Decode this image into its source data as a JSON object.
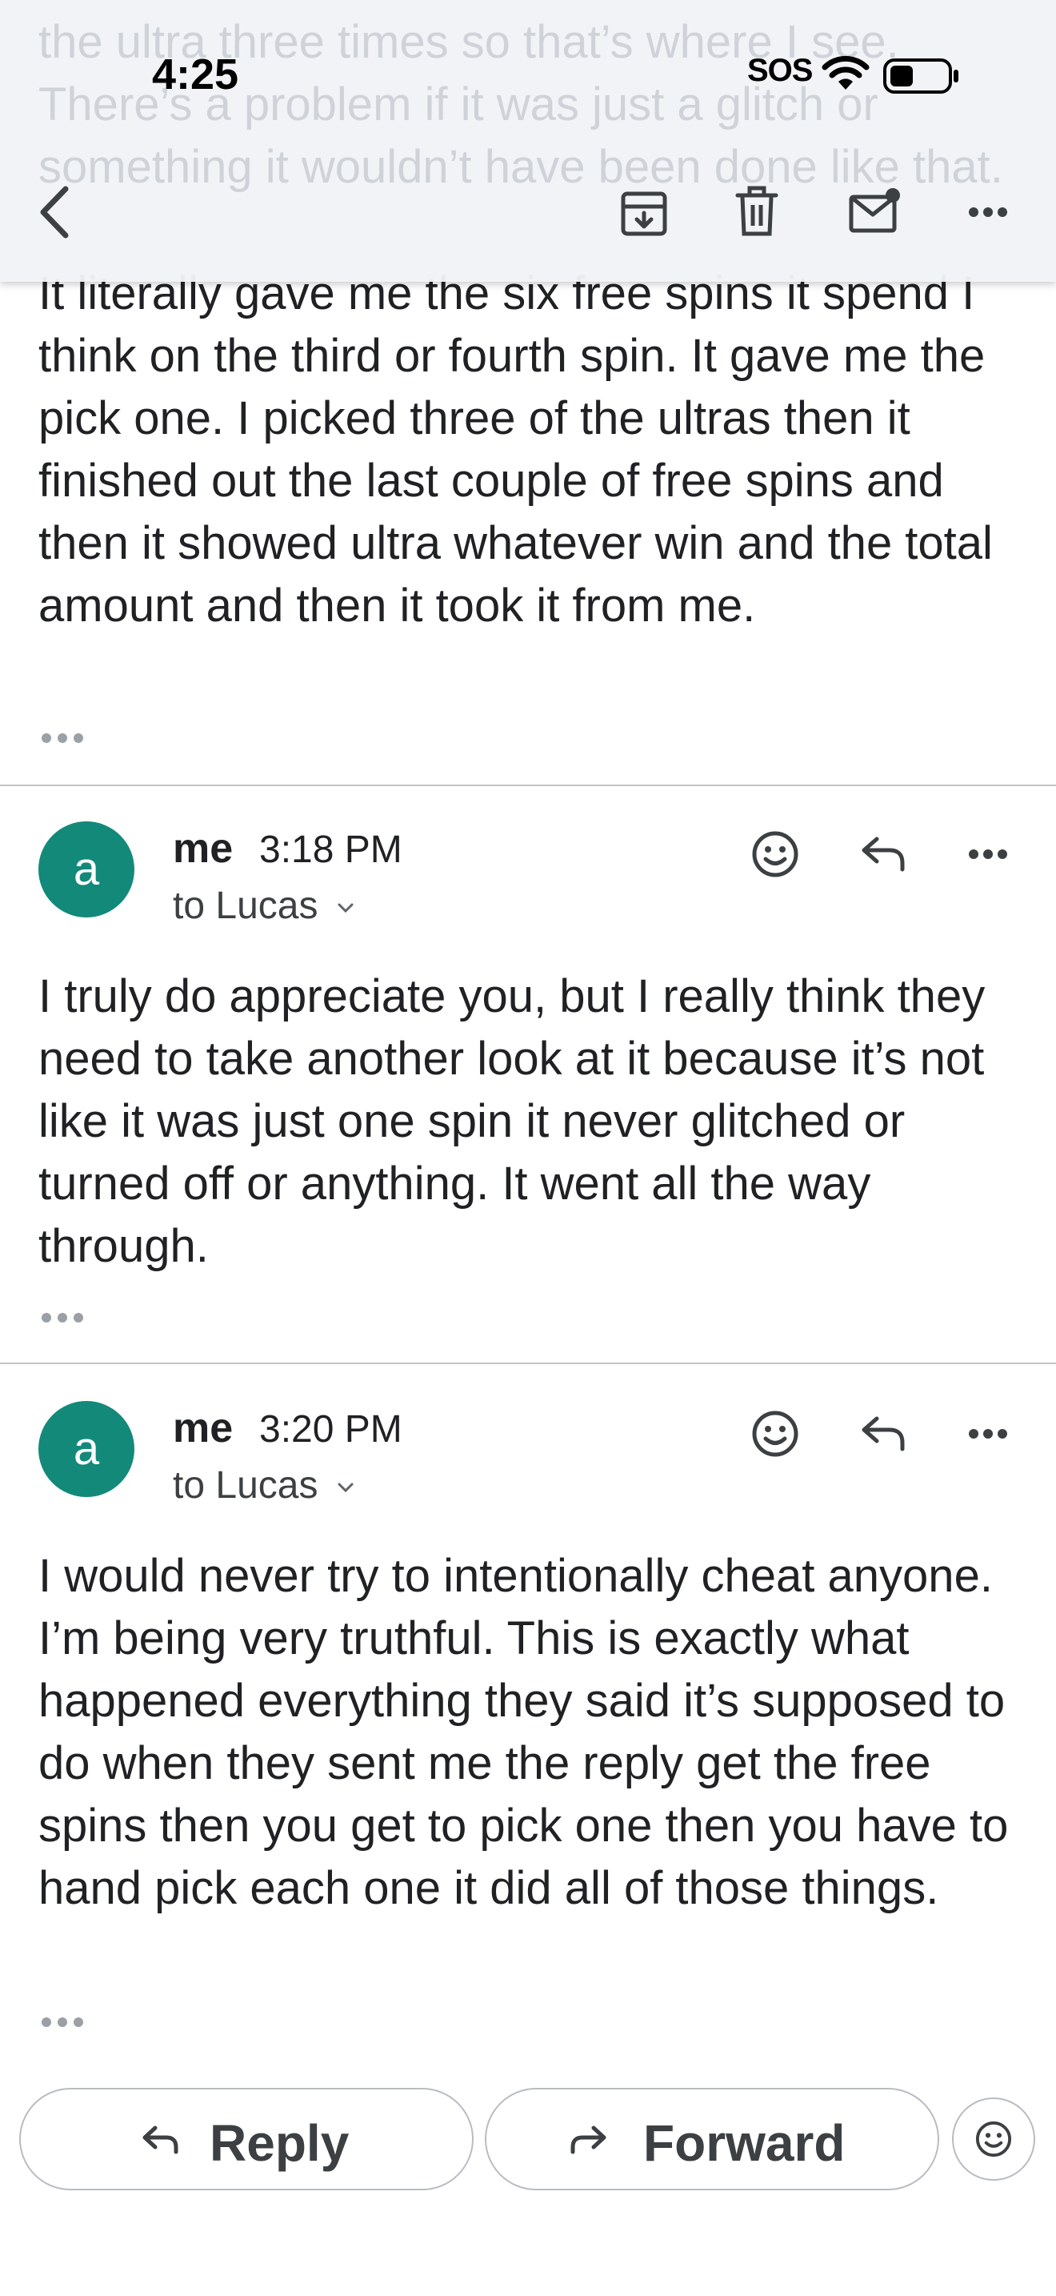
{
  "status_bar": {
    "time": "4:25",
    "sos": "SOS"
  },
  "ghost_text": "the ultra three times so that’s where I see. There’s a problem if it was just a glitch or something it wouldn’t have been done like that.",
  "toolbar": {
    "back_icon": "chevron-left-icon",
    "archive_icon": "archive-icon",
    "delete_icon": "trash-icon",
    "mark_unread_icon": "mail-unread-icon",
    "more_icon": "more-horizontal-icon"
  },
  "messages": [
    {
      "body": "It literally gave me the six free spins it spend I think on the third or fourth spin. It gave me the pick one. I picked three of the ultras then it finished out the last couple of free spins and then it showed ultra whatever win and the total amount and then it took it from me."
    },
    {
      "avatar": "a",
      "sender": "me",
      "time": "3:18 PM",
      "to": "to Lucas",
      "body": "I truly do appreciate you, but I really think they need to take another look at it because it’s not like it was just one spin it never glitched or turned off or anything. It went all the way through."
    },
    {
      "avatar": "a",
      "sender": "me",
      "time": "3:20 PM",
      "to": "to Lucas",
      "body": "I would never try to intentionally cheat anyone. I’m being very truthful. This is exactly what happened everything they said it’s supposed to do when they sent me the reply get the free spins then you get to pick one then you have to hand pick each one it did all of those things."
    }
  ],
  "actions": {
    "reply_label": "Reply",
    "forward_label": "Forward"
  },
  "colors": {
    "avatar_bg": "#13897a",
    "text": "#202124",
    "divider": "#c6c6c6"
  }
}
